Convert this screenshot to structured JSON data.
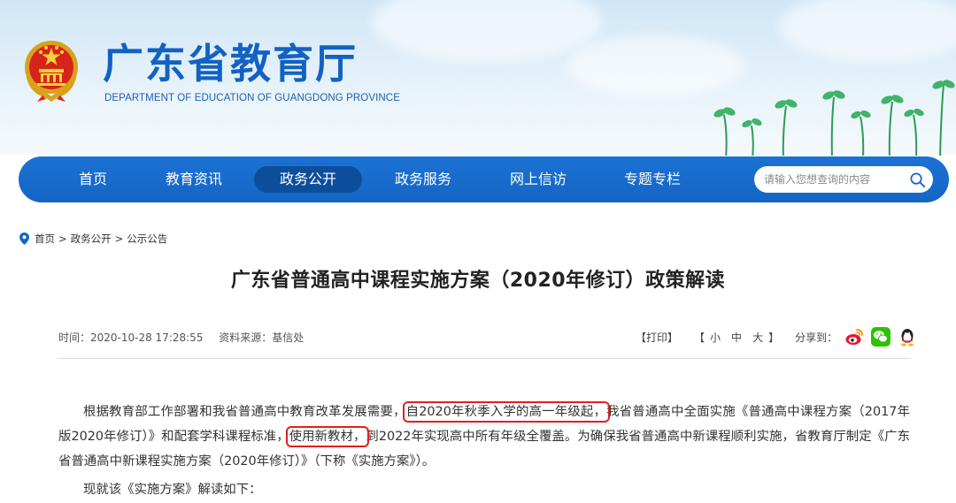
{
  "site": {
    "title": "广东省教育厅",
    "subtitle": "DEPARTMENT OF EDUCATION OF GUANGDONG PROVINCE"
  },
  "nav": {
    "items": [
      {
        "label": "首页"
      },
      {
        "label": "教育资讯"
      },
      {
        "label": "政务公开"
      },
      {
        "label": "政务服务"
      },
      {
        "label": "网上信访"
      },
      {
        "label": "专题专栏"
      }
    ],
    "active_index": 2,
    "search_placeholder": "请输入您想查询的内容"
  },
  "breadcrumb": {
    "items": [
      "首页",
      "政务公开",
      "公示公告"
    ],
    "separator": ">"
  },
  "article": {
    "title": "广东省普通高中课程实施方案（2020年修订）政策解读",
    "time": "时间：2020-10-28 17:28:55",
    "source": "资料来源：基信处",
    "print": "【打印】",
    "font_open": "【",
    "font_small": "小",
    "font_medium": "中",
    "font_large": "大",
    "font_close": "】",
    "share_label": "分享到：",
    "share_icons": [
      "weibo-icon",
      "wechat-icon",
      "qq-icon"
    ],
    "para1_a": "根据教育部工作部署和我省普通高中教育改革发展需要，",
    "para1_hl1": "自2020年秋季入学的高一年级起，",
    "para1_b": "我省普通高中全面实施《普通高中课程方案（2017年版2020年修订）》和配套学科课程标准，",
    "para1_hl2": "使用新教材，",
    "para1_c": "到2022年实现高中所有年级全覆盖。为确保我省普通高中新课程顺利实施，省教育厅制定《广东省普通高中新课程实施方案（2020年修订）》（下称《实施方案》）。",
    "para2": "现就该《实施方案》解读如下："
  },
  "colors": {
    "brand_blue": "#1262c3",
    "nav_blue": "#1465c5",
    "nav_active": "#0d4e9c",
    "highlight_red": "#e02020"
  }
}
